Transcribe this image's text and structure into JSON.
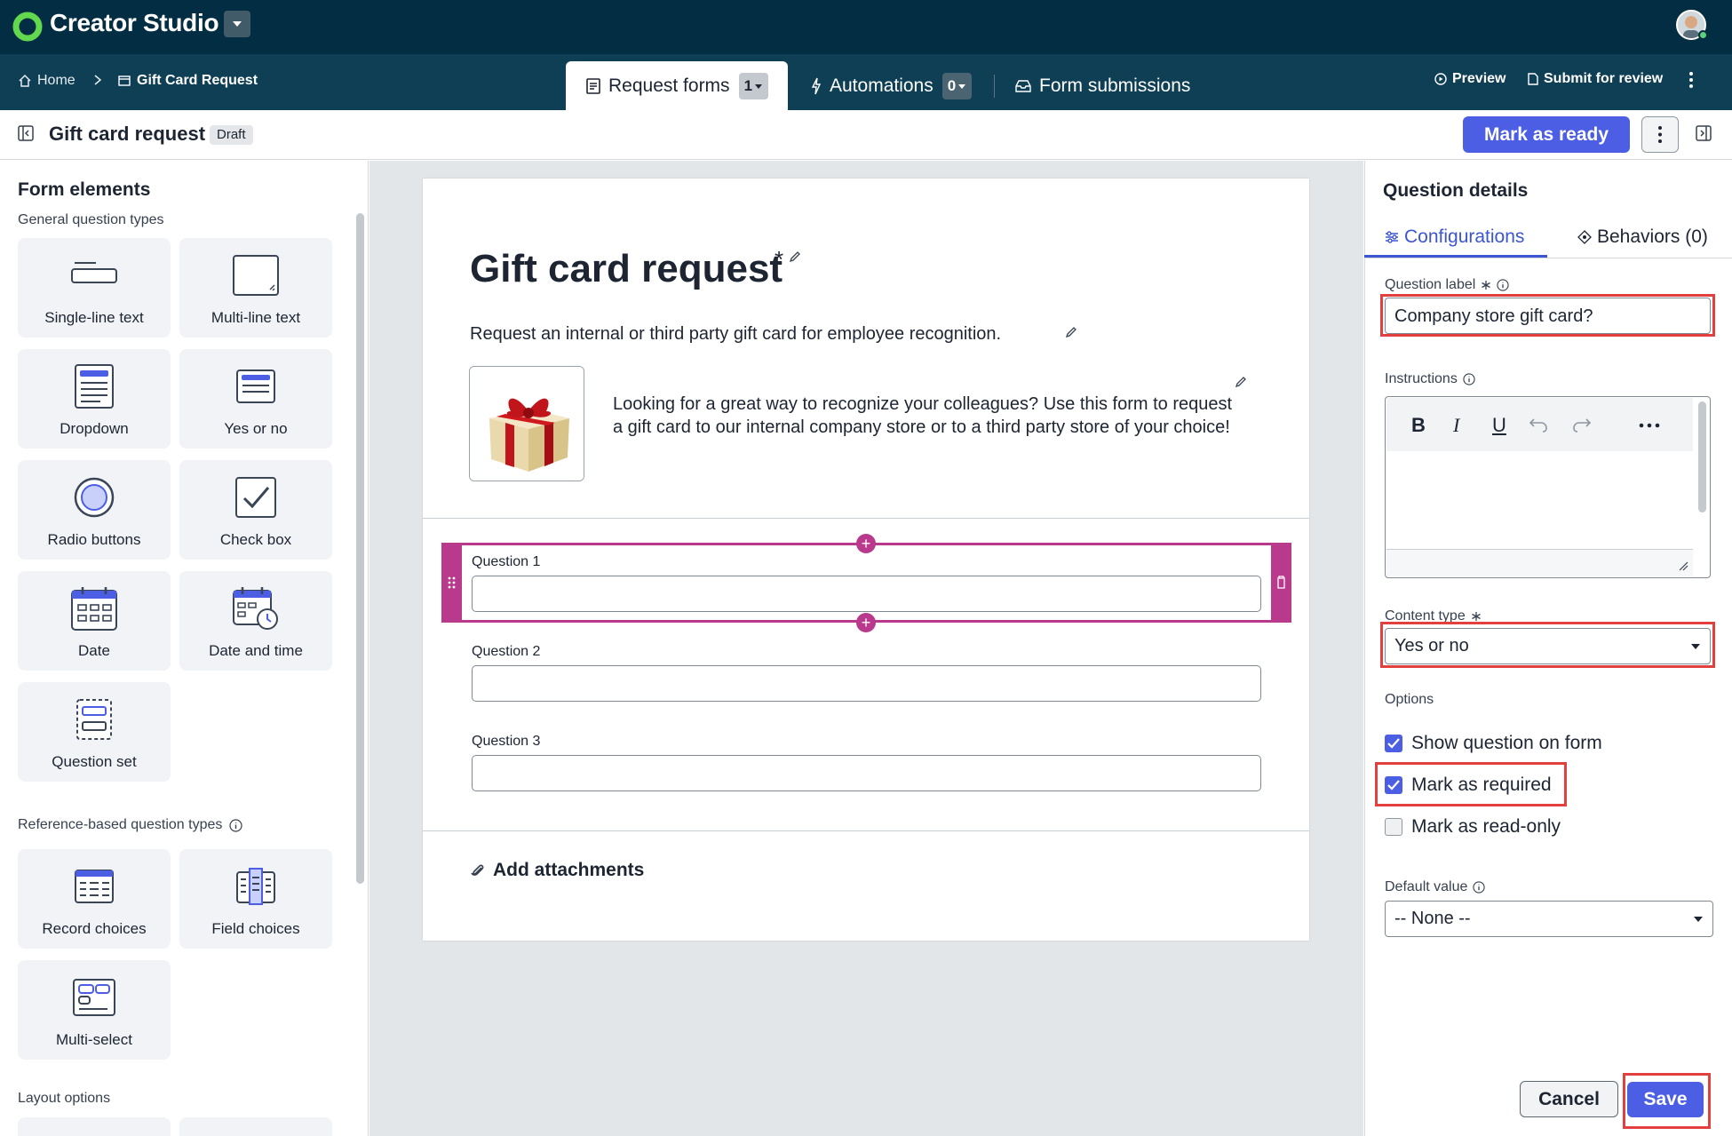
{
  "app": {
    "brand": "Creator Studio"
  },
  "breadcrumb": {
    "home": "Home",
    "current": "Gift Card Request"
  },
  "tabs": [
    {
      "label": "Request forms",
      "count": "1"
    },
    {
      "label": "Automations",
      "count": "0"
    },
    {
      "label": "Form submissions"
    }
  ],
  "nav_actions": {
    "preview": "Preview",
    "submit": "Submit for review"
  },
  "header": {
    "title": "Gift card request",
    "status": "Draft",
    "mark_ready": "Mark as ready"
  },
  "left": {
    "title": "Form elements",
    "general_heading": "General question types",
    "general": [
      "Single-line text",
      "Multi-line text",
      "Dropdown",
      "Yes or no",
      "Radio buttons",
      "Check box",
      "Date",
      "Date and time",
      "Question set"
    ],
    "reference_heading": "Reference-based question types",
    "reference": [
      "Record choices",
      "Field choices",
      "Multi-select"
    ],
    "layout_heading": "Layout options"
  },
  "form": {
    "title": "Gift card request",
    "title_marker": "*",
    "description": "Request an internal or third party gift card for employee recognition.",
    "intro": "Looking for a great way to recognize your colleagues? Use this form to request a gift card to our internal company store or to a third party store of your choice!",
    "questions": [
      "Question 1",
      "Question 2",
      "Question 3"
    ],
    "attachments": "Add attachments"
  },
  "details": {
    "title": "Question details",
    "tab_config": "Configurations",
    "tab_behaviors": "Behaviors (0)",
    "question_label_label": "Question label",
    "question_label_value": "Company store gift card?",
    "instructions_label": "Instructions",
    "content_type_label": "Content type",
    "content_type_value": "Yes or no",
    "options_label": "Options",
    "options": [
      {
        "label": "Show question on form",
        "checked": true
      },
      {
        "label": "Mark as required",
        "checked": true
      },
      {
        "label": "Mark as read-only",
        "checked": false
      }
    ],
    "default_label": "Default value",
    "default_value": "-- None --",
    "cancel": "Cancel",
    "save": "Save"
  },
  "colors": {
    "accent": "#4b5ee4",
    "selection": "#b93a8d",
    "highlight": "#e2403f",
    "topbar": "#032d42"
  }
}
